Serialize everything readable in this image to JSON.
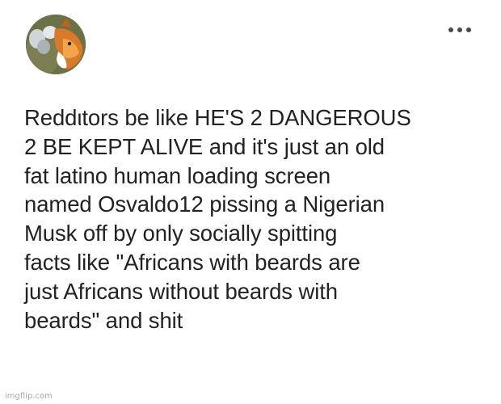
{
  "post": {
    "avatar_icon": "avatar-photo",
    "more_icon": "more-options-icon",
    "body_text": "Reddιtors be like HE'S 2 DANGEROUS\n2 BE KEPT ALIVE and it's just an old\nfat latino human loading screen\nnamed Osvaldo12 pissing a Nigerian\nMusk off by only socially spitting\nfacts like \"Africans with beards are\njust Africans without beards with\nbeards\" and shit"
  },
  "watermark": {
    "text": "imgflip.com"
  }
}
